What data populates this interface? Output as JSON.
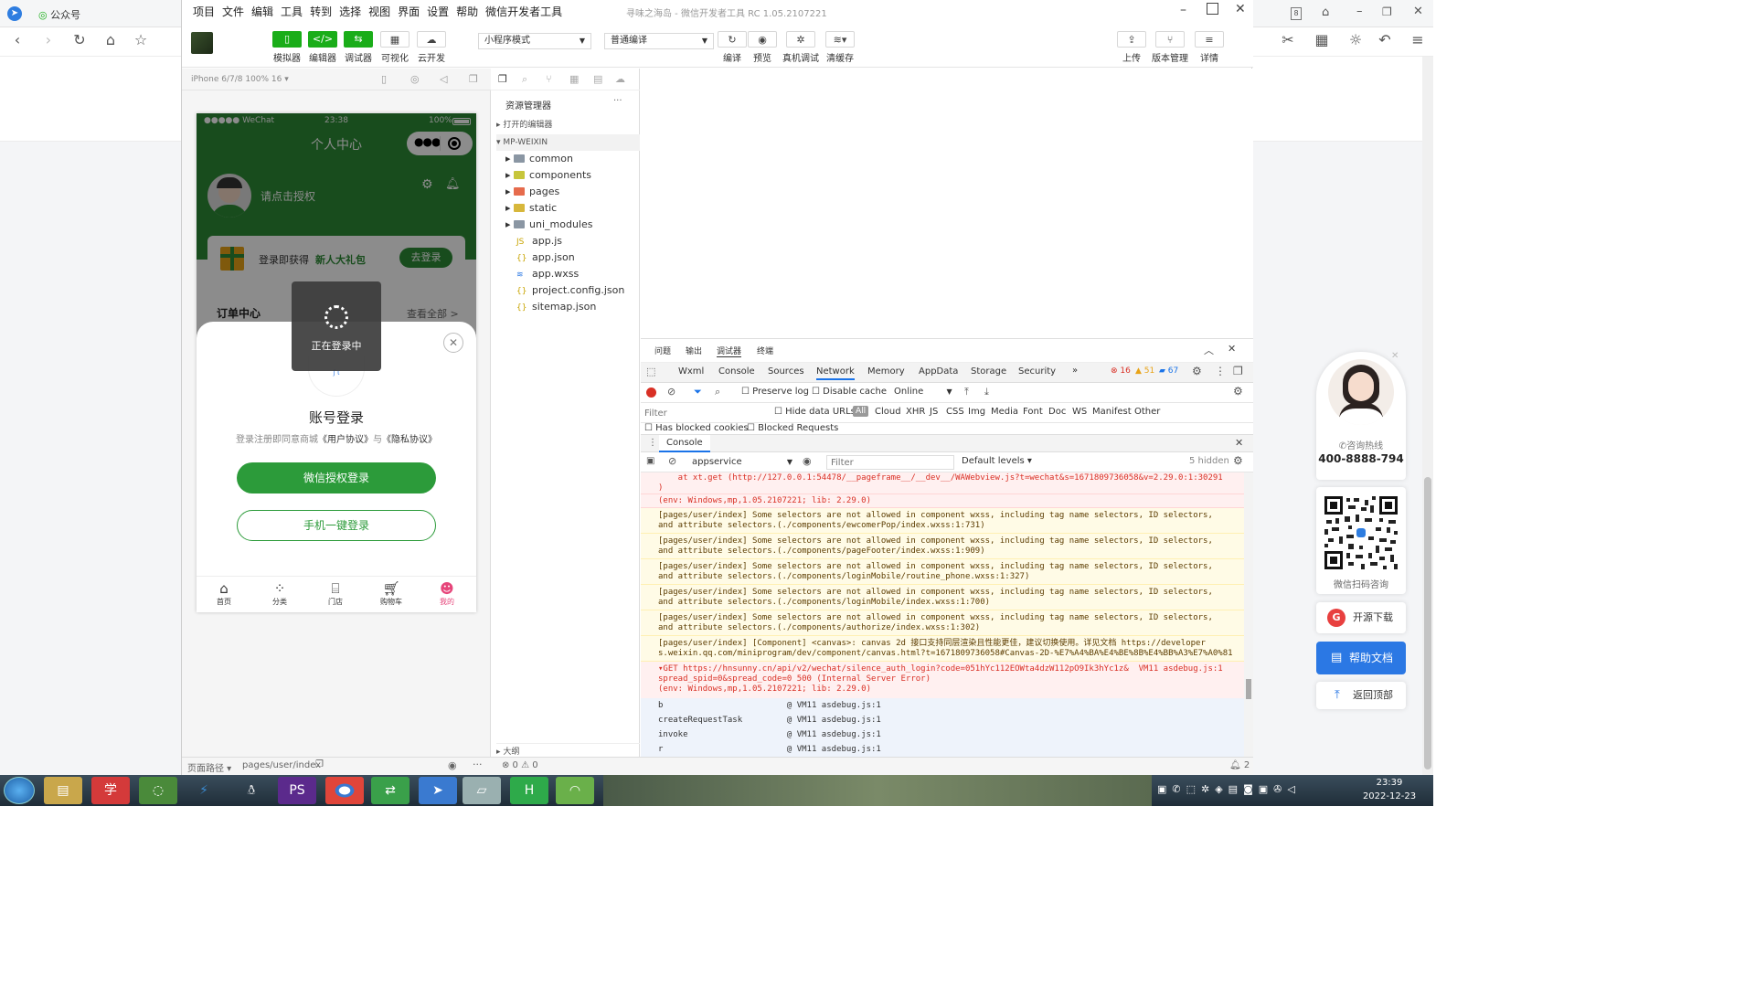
{
  "browser": {
    "tab_title": "公众号",
    "nav": {
      "back": "back-icon",
      "forward": "forward-icon",
      "refresh": "refresh-icon",
      "home": "home-icon",
      "star": "star-icon"
    },
    "tab_count": "8"
  },
  "ide": {
    "menu": [
      "项目",
      "文件",
      "编辑",
      "工具",
      "转到",
      "选择",
      "视图",
      "界面",
      "设置",
      "帮助",
      "微信开发者工具"
    ],
    "window_title": "寻味之海岛 - 微信开发者工具 RC 1.05.2107221",
    "toolbar": {
      "simulator": "模拟器",
      "editor": "编辑器",
      "debugger": "调试器",
      "visual": "可视化",
      "cloud": "云开发",
      "mode_select": "小程序模式",
      "compile_select": "普通编译",
      "compile": "编译",
      "preview": "预览",
      "real_debug": "真机调试",
      "clear_cache": "清缓存",
      "upload": "上传",
      "version": "版本管理",
      "details": "详情"
    },
    "sim_header": "iPhone 6/7/8 100% 16 ▾",
    "explorer": {
      "title": "资源管理器",
      "open_editors": "打开的编辑器",
      "project": "MP-WEIXIN",
      "folders": [
        "common",
        "components",
        "pages",
        "static",
        "uni_modules"
      ],
      "files": [
        "app.js",
        "app.json",
        "app.wxss",
        "project.config.json",
        "sitemap.json"
      ],
      "outline": "大纲",
      "status": "⊗ 0 ⚠ 0"
    },
    "status_bar": {
      "page_path_label": "页面路径 ▾",
      "page_path": "pages/user/index",
      "notify": "2"
    }
  },
  "phone": {
    "status_carrier": "●●●●● WeChat",
    "status_time": "23:38",
    "status_battery": "100%",
    "nav_title": "个人中心",
    "auth_prompt": "请点击授权",
    "gift_text": "登录即获得",
    "gift_highlight": "新人大礼包",
    "login_btn": "去登录",
    "orders": "订单中心",
    "view_all": "查看全部 >",
    "loading": "正在登录中",
    "modal_title": "账号登录",
    "agree_prefix": "登录注册即同意商城",
    "user_agreement": "《用户协议》",
    "agree_and": "与",
    "privacy": "《隐私协议》",
    "wechat_login": "微信授权登录",
    "phone_login": "手机一键登录",
    "tabs": [
      "首页",
      "分类",
      "门店",
      "购物车",
      "我的"
    ],
    "accent": "#2c8a35",
    "tab_active_color": "#e6457a"
  },
  "debugger": {
    "top_tabs": [
      "问题",
      "输出",
      "调试器",
      "终端"
    ],
    "panels": [
      "Wxml",
      "Console",
      "Sources",
      "Network",
      "Memory",
      "AppData",
      "Storage",
      "Security",
      "»"
    ],
    "err_count": "16",
    "warn_count": "51",
    "info_count": "67",
    "preserve_log": "Preserve log",
    "disable_cache": "Disable cache",
    "online": "Online",
    "filter_placeholder": "Filter",
    "hide_data_urls": "Hide data URLs",
    "types": [
      "All",
      "Cloud",
      "XHR",
      "JS",
      "CSS",
      "Img",
      "Media",
      "Font",
      "Doc",
      "WS",
      "Manifest",
      "Other"
    ],
    "has_blocked_cookies": "Has blocked cookies",
    "blocked_requests": "Blocked Requests",
    "drawer_title": "Console",
    "context": "appservice",
    "console_filter": "Filter",
    "levels": "Default levels ▾",
    "hidden": "5 hidden",
    "lines": [
      {
        "kind": "err",
        "text": "    at xt.get (http://127.0.0.1:54478/__pageframe__/__dev__/WAWebview.js?t=wechat&s=1671809736058&v=2.29.0:1:30291\n)"
      },
      {
        "kind": "err",
        "text": "(env: Windows,mp,1.05.2107221; lib: 2.29.0)"
      },
      {
        "kind": "warn",
        "text": "[pages/user/index] Some selectors are not allowed in component wxss, including tag name selectors, ID selectors,\nand attribute selectors.(./components/ewcomerPop/index.wxss:1:731)"
      },
      {
        "kind": "warn",
        "text": "[pages/user/index] Some selectors are not allowed in component wxss, including tag name selectors, ID selectors,\nand attribute selectors.(./components/pageFooter/index.wxss:1:909)"
      },
      {
        "kind": "warn",
        "text": "[pages/user/index] Some selectors are not allowed in component wxss, including tag name selectors, ID selectors,\nand attribute selectors.(./components/loginMobile/routine_phone.wxss:1:327)"
      },
      {
        "kind": "warn",
        "text": "[pages/user/index] Some selectors are not allowed in component wxss, including tag name selectors, ID selectors,\nand attribute selectors.(./components/loginMobile/index.wxss:1:700)"
      },
      {
        "kind": "warn",
        "text": "[pages/user/index] Some selectors are not allowed in component wxss, including tag name selectors, ID selectors,\nand attribute selectors.(./components/authorize/index.wxss:1:302)"
      },
      {
        "kind": "warn",
        "text": "[pages/user/index] [Component] <canvas>: canvas 2d 接口支持同层渲染且性能更佳，建议切换使用。详见文档 https://developer\ns.weixin.qq.com/miniprogram/dev/component/canvas.html?t=1671809736058#Canvas-2D-%E7%A4%BA%E4%BE%8B%E4%BB%A3%E7%A0%81"
      },
      {
        "kind": "get",
        "text": "▾GET https://hnsunny.cn/api/v2/wechat/silence_auth_login?code=051hYc112EOWta4dzW112pO9Ik3hYc1z&  VM11 asdebug.js:1\nspread_spid=0&spread_code=0 500 (Internal Server Error)\n(env: Windows,mp,1.05.2107221; lib: 2.29.0)"
      },
      {
        "kind": "stack",
        "text": "b                         @ VM11 asdebug.js:1"
      },
      {
        "kind": "stack",
        "text": "createRequestTask         @ VM11 asdebug.js:1"
      },
      {
        "kind": "stack",
        "text": "invoke                    @ VM11 asdebug.js:1"
      },
      {
        "kind": "stack",
        "text": "r                         @ VM11 asdebug.js:1"
      }
    ]
  },
  "side_widget": {
    "hotline_label": "咨询热线",
    "hotline": "400-8888-794",
    "qr_label": "微信扫码咨询",
    "open_source": "开源下载",
    "help": "帮助文档",
    "back_top": "返回顶部"
  },
  "taskbar": {
    "time": "23:39",
    "date": "2022-12-23"
  }
}
